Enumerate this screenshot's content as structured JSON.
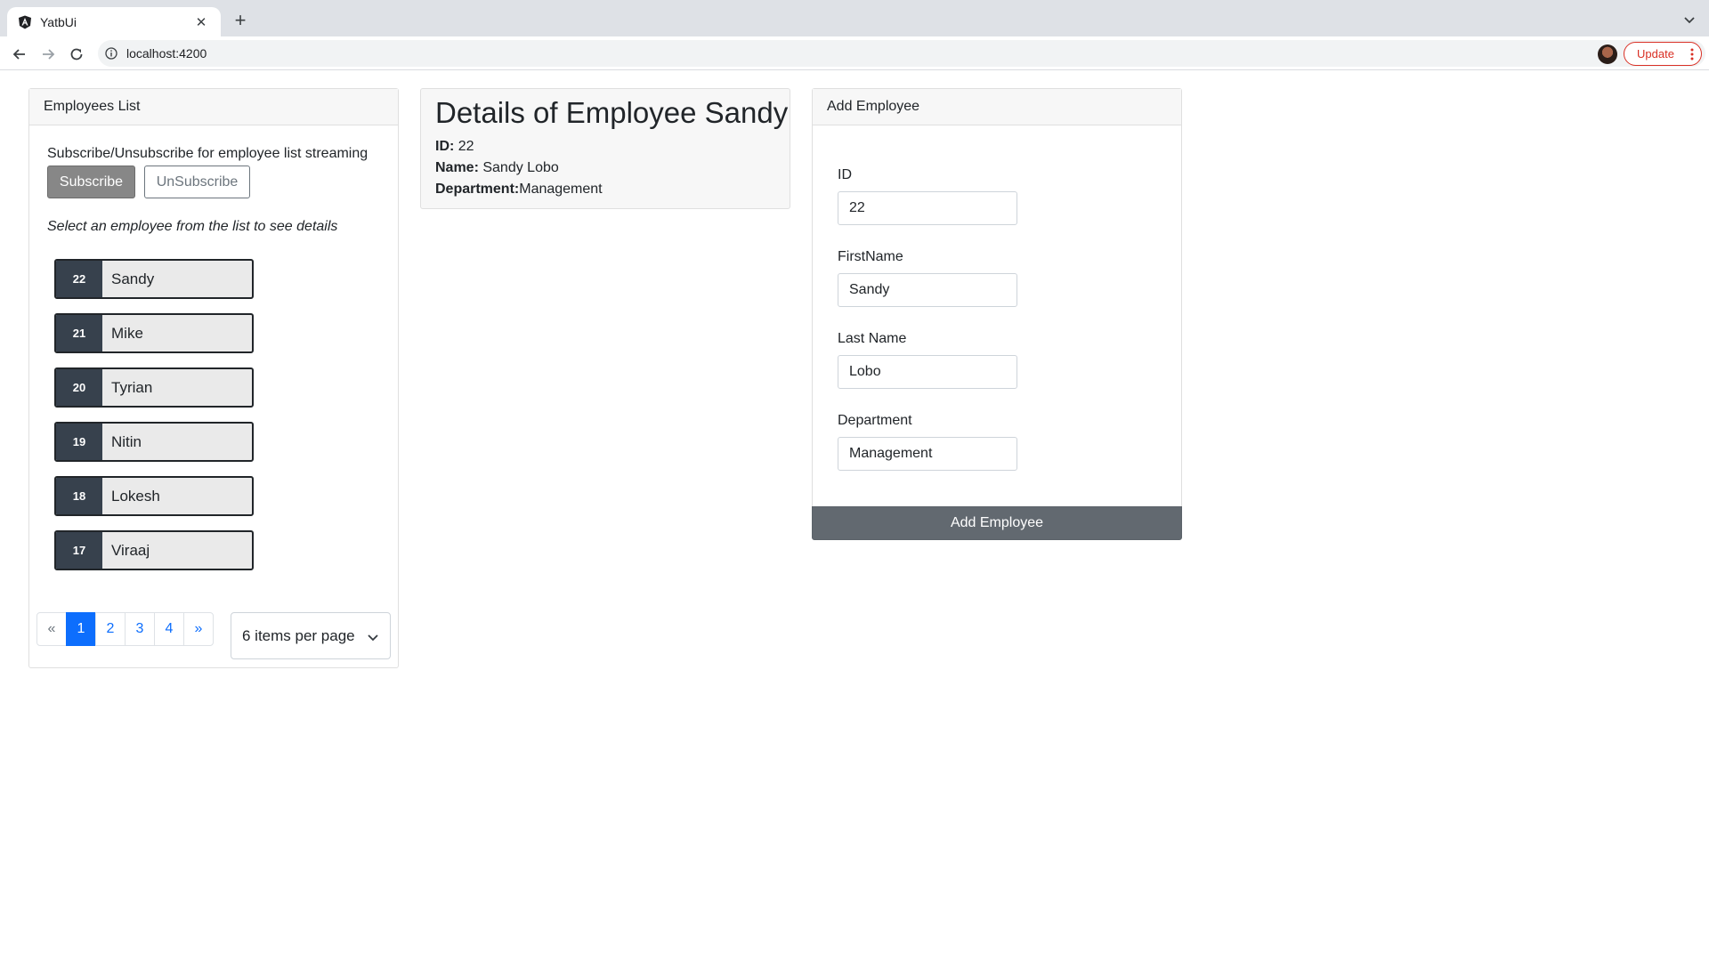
{
  "browser": {
    "tab_title": "YatbUi",
    "tab_close": "✕",
    "new_tab": "+",
    "url": "localhost:4200",
    "update_label": "Update",
    "icons": [
      "angular-favicon-icon",
      "back-icon",
      "forward-icon",
      "reload-icon",
      "info-icon",
      "share-icon",
      "star-icon",
      "kebab-menu-icon",
      "tab-list-icon"
    ]
  },
  "employees_list": {
    "header": "Employees List",
    "subscribe_text": "Subscribe/Unsubscribe for employee list streaming",
    "subscribe_label": "Subscribe",
    "unsubscribe_label": "UnSubscribe",
    "select_hint": "Select an employee from the list to see details",
    "items": [
      {
        "id": "22",
        "name": "Sandy"
      },
      {
        "id": "21",
        "name": "Mike"
      },
      {
        "id": "20",
        "name": "Tyrian"
      },
      {
        "id": "19",
        "name": "Nitin"
      },
      {
        "id": "18",
        "name": "Lokesh"
      },
      {
        "id": "17",
        "name": "Viraaj"
      }
    ],
    "pagination": {
      "prev": "«",
      "pages": [
        "1",
        "2",
        "3",
        "4"
      ],
      "active_page": "1",
      "next": "»"
    },
    "per_page": "6 items per page"
  },
  "details": {
    "title": "Details of Employee Sandy",
    "id_label": "ID:",
    "id_value": " 22",
    "name_label": "Name:",
    "name_value": " Sandy Lobo",
    "dept_label": "Department:",
    "dept_value": "Management"
  },
  "add_employee": {
    "header": "Add Employee",
    "fields": [
      {
        "label": "ID",
        "value": "22"
      },
      {
        "label": "FirstName",
        "value": "Sandy"
      },
      {
        "label": "Last Name",
        "value": "Lobo"
      },
      {
        "label": "Department",
        "value": "Management"
      }
    ],
    "submit_label": "Add Employee"
  },
  "colors": {
    "primary": "#0d6efd",
    "badge": "#37414d",
    "secondary_btn": "#626970",
    "update_red": "#d93025"
  }
}
